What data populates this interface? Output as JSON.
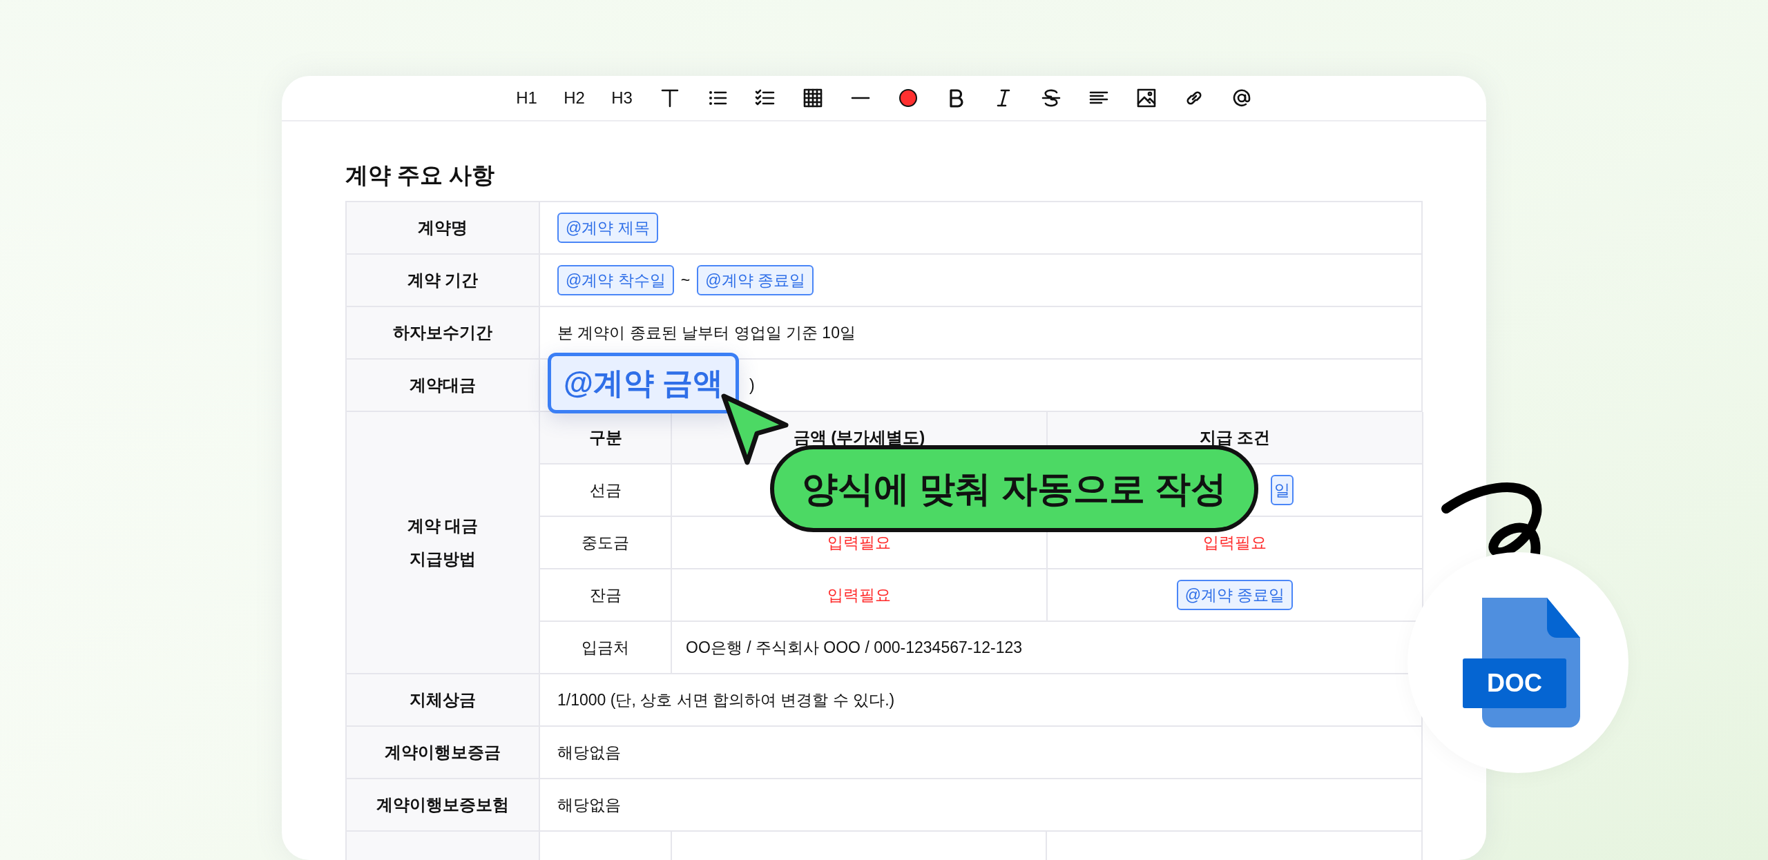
{
  "toolbar": {
    "headings": [
      "H1",
      "H2",
      "H3"
    ]
  },
  "section_title": "계약 주요 사항",
  "table": {
    "rows": [
      {
        "kind": "plain",
        "label": "계약명",
        "value": [
          {
            "kind": "chip",
            "text": "@계약 제목"
          }
        ]
      },
      {
        "kind": "plain",
        "label": "계약 기간",
        "value": [
          {
            "kind": "chip",
            "text": "@계약 착수일"
          },
          {
            "kind": "text",
            "text": "~"
          },
          {
            "kind": "chip",
            "text": "@계약 종료일"
          }
        ]
      },
      {
        "kind": "plain",
        "label": "하자보수기간",
        "value": [
          {
            "kind": "text",
            "text": "본 계약이 종료된 날부터 영업일 기준 10일"
          }
        ]
      },
      {
        "kind": "amount",
        "label": "계약대금",
        "value": [
          {
            "kind": "text",
            "text": ")"
          }
        ]
      },
      {
        "kind": "nested",
        "label": "계약 대금\n지급방법",
        "columns": [
          "구분",
          "금액 (부가세별도)",
          "지급 조건"
        ],
        "rows": [
          {
            "kind": "split",
            "cells": [
              [
                {
                  "kind": "text",
                  "text": "선금"
                }
              ],
              [],
              [
                {
                  "kind": "chip",
                  "text": "일"
                }
              ]
            ]
          },
          {
            "kind": "split",
            "cells": [
              [
                {
                  "kind": "text",
                  "text": "중도금"
                }
              ],
              [
                {
                  "kind": "required",
                  "text": "입력필요"
                }
              ],
              [
                {
                  "kind": "required",
                  "text": "입력필요"
                }
              ]
            ]
          },
          {
            "kind": "split",
            "cells": [
              [
                {
                  "kind": "text",
                  "text": "잔금"
                }
              ],
              [
                {
                  "kind": "required",
                  "text": "입력필요"
                }
              ],
              [
                {
                  "kind": "chip",
                  "text": "@계약 종료일"
                }
              ]
            ]
          },
          {
            "kind": "span",
            "cells": [
              [
                {
                  "kind": "text",
                  "text": "입금처"
                }
              ],
              [
                {
                  "kind": "text",
                  "text": "OO은행 / 주식회사 OOO / 000-1234567-12-123"
                }
              ]
            ]
          }
        ]
      },
      {
        "kind": "plain",
        "label": "지체상금",
        "value": [
          {
            "kind": "text",
            "text": "1/1000 (단, 상호 서면 합의하여 변경할 수 있다.)"
          }
        ]
      },
      {
        "kind": "plain",
        "label": "계약이행보증금",
        "value": [
          {
            "kind": "text",
            "text": "해당없음"
          }
        ]
      },
      {
        "kind": "plain",
        "label": "계약이행보증보험",
        "value": [
          {
            "kind": "text",
            "text": "해당없음"
          }
        ]
      },
      {
        "kind": "cut",
        "cells": [
          [],
          [],
          []
        ]
      }
    ]
  },
  "highlight_tag": {
    "text": "@계약 금액"
  },
  "callout": {
    "text": "양식에 맞춰 자동으로 작성"
  },
  "doc_badge": {
    "text": "DOC"
  }
}
